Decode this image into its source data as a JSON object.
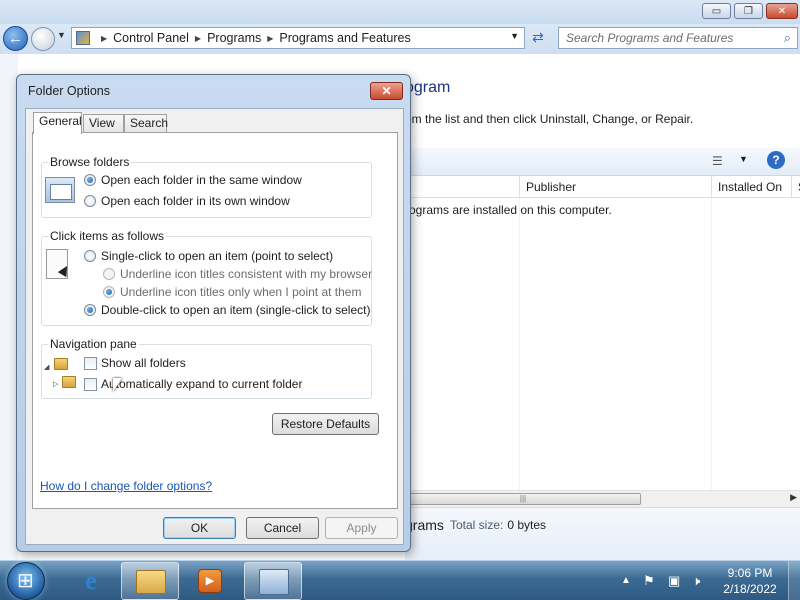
{
  "window": {
    "caption_buttons": {
      "minimize": "▭",
      "maximize": "❐",
      "close": "✕"
    },
    "breadcrumb": [
      "Control Panel",
      "Programs",
      "Programs and Features"
    ],
    "search_placeholder": "Search Programs and Features",
    "heading_partial": "ogram",
    "instruction_partial": "om the list and then click Uninstall, Change, or Repair.",
    "columns": [
      "Publisher",
      "Installed On",
      "S"
    ],
    "empty_message_partial": "rograms are installed on this computer.",
    "details_title_partial": "grams",
    "details_total_label": "Total size:",
    "details_total_value": "0 bytes"
  },
  "dialog": {
    "title": "Folder Options",
    "close_label": "✕",
    "tabs": [
      "General",
      "View",
      "Search"
    ],
    "active_tab": "General",
    "browse_folders": {
      "label": "Browse folders",
      "options": [
        "Open each folder in the same window",
        "Open each folder in its own window"
      ],
      "selected": 0
    },
    "click_items": {
      "label": "Click items as follows",
      "single_click": "Single-click to open an item (point to select)",
      "underline_browser": "Underline icon titles consistent with my browser",
      "underline_point": "Underline icon titles only when I point at them",
      "double_click": "Double-click to open an item (single-click to select)",
      "selected": "double_click"
    },
    "navigation_pane": {
      "label": "Navigation pane",
      "show_all_folders": "Show all folders",
      "show_all_folders_checked": false,
      "auto_expand": "Automatically expand to current folder",
      "auto_expand_checked": false
    },
    "restore_defaults": "Restore Defaults",
    "help_link": "How do I change folder options?",
    "buttons": {
      "ok": "OK",
      "cancel": "Cancel",
      "apply": "Apply"
    }
  },
  "taskbar": {
    "time": "9:06 PM",
    "date": "2/18/2022",
    "pinned": [
      "internet-explorer",
      "windows-explorer",
      "windows-media-player",
      "control-panel"
    ],
    "active_item": "control-panel"
  }
}
